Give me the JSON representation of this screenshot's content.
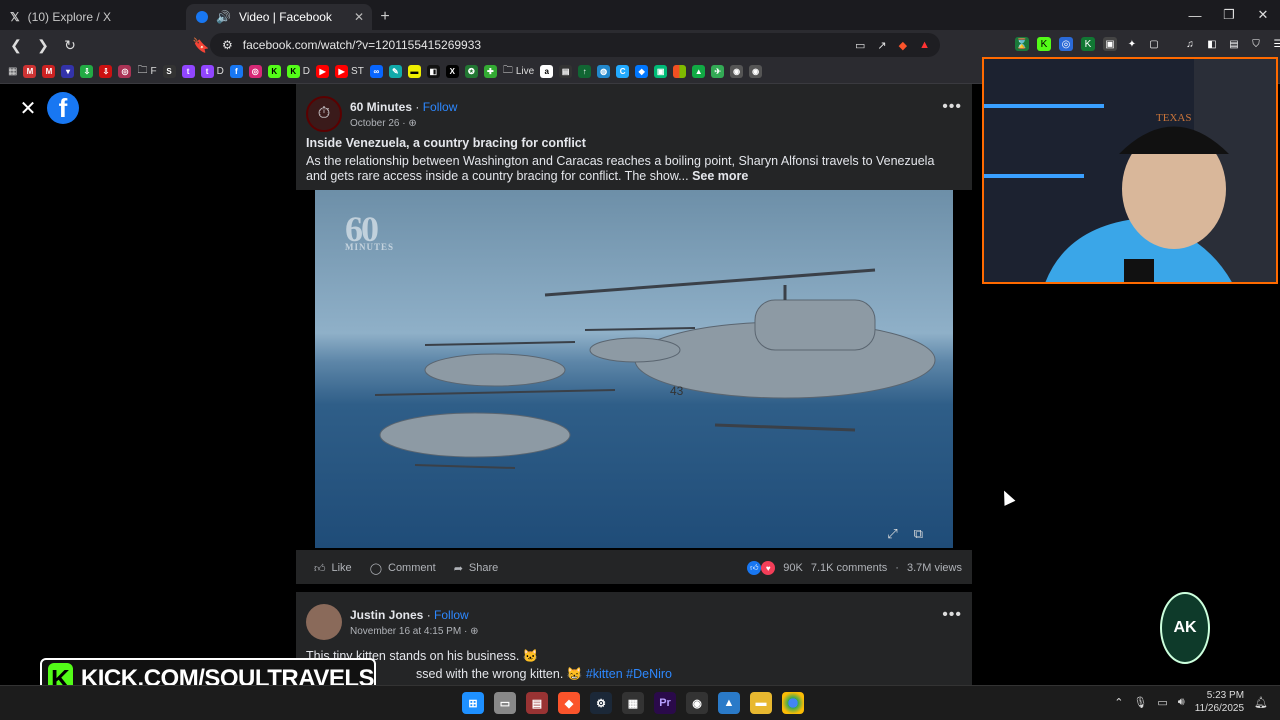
{
  "tabs": [
    {
      "label": "(10) Explore / X"
    },
    {
      "label": "Video | Facebook"
    }
  ],
  "addressbar": {
    "url": "facebook.com/watch/?v=1201155415269933"
  },
  "bookmarks": [
    "F",
    "D",
    "D",
    "ST",
    "Live"
  ],
  "post1": {
    "author": "60 Minutes",
    "follow": "Follow",
    "separator": " · ",
    "date": "October 26 · ",
    "title": "Inside Venezuela, a country bracing for conflict",
    "description": "As the relationship between Washington and Caracas reaches a boiling point, Sharyn Alfonsi travels to Venezuela and gets rare access inside a country bracing for conflict. The show... ",
    "see_more": "See more",
    "watermark": "60",
    "watermark_sub": "MINUTES",
    "like": "Like",
    "comment": "Comment",
    "share": "Share",
    "reactions": "90K",
    "comments": "7.1K comments",
    "separator2": " · ",
    "views": "3.7M views",
    "heli_number": "43"
  },
  "post2": {
    "author": "Justin Jones",
    "follow": "Follow",
    "date": "November 16 at 4:15 PM · ",
    "line1": "This tiny kitten stands on his business. 🐱",
    "line2": "ssed with the wrong kitten. 😸",
    "tag1": "#kitten",
    "tag2": "#DeNiro"
  },
  "cam": {
    "cap": "TEXAS"
  },
  "overlay": {
    "kick": "KICK.COM/SOULTRAVELS",
    "badge": "AK"
  },
  "clock": {
    "time": "5:23 PM",
    "date": "11/26/2025"
  },
  "colors": {
    "accent": "#1877f2",
    "kick": "#53fc18",
    "cam_border": "#ff6a00"
  }
}
